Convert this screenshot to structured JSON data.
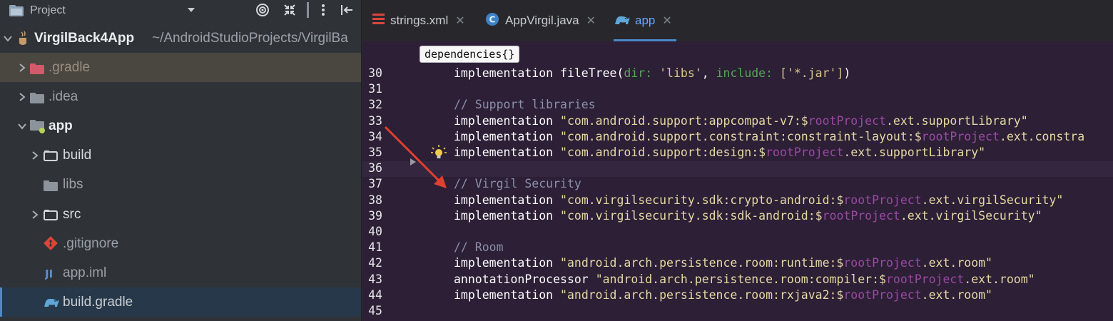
{
  "project_panel": {
    "title": "Project",
    "tree": [
      {
        "label": "VirgilBack4App",
        "path": "~/AndroidStudioProjects/VirgilBa"
      },
      {
        "label": ".gradle"
      },
      {
        "label": ".idea"
      },
      {
        "label": "app"
      },
      {
        "label": "build"
      },
      {
        "label": "libs"
      },
      {
        "label": "src"
      },
      {
        "label": ".gitignore"
      },
      {
        "label": "app.iml"
      },
      {
        "label": "build.gradle"
      }
    ]
  },
  "tabs": [
    {
      "label": "strings.xml"
    },
    {
      "label": "AppVirgil.java"
    },
    {
      "label": "app"
    }
  ],
  "breadcrumb": "dependencies{}",
  "lines": [
    {
      "n": "30",
      "parts": [
        {
          "t": "implementation fileTree(",
          "c": "kw"
        },
        {
          "t": "dir: ",
          "c": "nm"
        },
        {
          "t": "'libs'",
          "c": "sq"
        },
        {
          "t": ", ",
          "c": "kw"
        },
        {
          "t": "include: ",
          "c": "nm"
        },
        {
          "t": "['*.jar']",
          "c": "sq"
        },
        {
          "t": ")",
          "c": "kw"
        }
      ]
    },
    {
      "n": "31",
      "parts": []
    },
    {
      "n": "32",
      "parts": [
        {
          "t": "// Support libraries",
          "c": "cmt"
        }
      ]
    },
    {
      "n": "33",
      "parts": [
        {
          "t": "implementation ",
          "c": "kw"
        },
        {
          "t": "\"com.android.support:appcompat-v7:$",
          "c": "str"
        },
        {
          "t": "rootProject",
          "c": "var"
        },
        {
          "t": ".ext.supportLibrary\"",
          "c": "str"
        }
      ]
    },
    {
      "n": "34",
      "parts": [
        {
          "t": "implementation ",
          "c": "kw"
        },
        {
          "t": "\"com.android.support.constraint:constraint-layout:$",
          "c": "str"
        },
        {
          "t": "rootProject",
          "c": "var"
        },
        {
          "t": ".ext.constra",
          "c": "str"
        }
      ]
    },
    {
      "n": "35",
      "parts": [
        {
          "t": "implementation ",
          "c": "kw"
        },
        {
          "t": "\"com.android.support:design:$",
          "c": "str"
        },
        {
          "t": "rootProject",
          "c": "var"
        },
        {
          "t": ".ext.supportLibrary\"",
          "c": "str"
        }
      ]
    },
    {
      "n": "36",
      "parts": []
    },
    {
      "n": "37",
      "parts": [
        {
          "t": "// Virgil Security",
          "c": "cmt"
        }
      ]
    },
    {
      "n": "38",
      "parts": [
        {
          "t": "implementation ",
          "c": "kw"
        },
        {
          "t": "\"com.virgilsecurity.sdk:crypto-android:$",
          "c": "str"
        },
        {
          "t": "rootProject",
          "c": "var"
        },
        {
          "t": ".ext.virgilSecurity\"",
          "c": "str"
        }
      ]
    },
    {
      "n": "39",
      "parts": [
        {
          "t": "implementation ",
          "c": "kw"
        },
        {
          "t": "\"com.virgilsecurity.sdk:sdk-android:$",
          "c": "str"
        },
        {
          "t": "rootProject",
          "c": "var"
        },
        {
          "t": ".ext.virgilSecurity\"",
          "c": "str"
        }
      ]
    },
    {
      "n": "40",
      "parts": []
    },
    {
      "n": "41",
      "parts": [
        {
          "t": "// Room",
          "c": "cmt"
        }
      ]
    },
    {
      "n": "42",
      "parts": [
        {
          "t": "implementation ",
          "c": "kw"
        },
        {
          "t": "\"android.arch.persistence.room:runtime:$",
          "c": "str"
        },
        {
          "t": "rootProject",
          "c": "var"
        },
        {
          "t": ".ext.room\"",
          "c": "str"
        }
      ]
    },
    {
      "n": "43",
      "parts": [
        {
          "t": "annotationProcessor ",
          "c": "kw"
        },
        {
          "t": "\"android.arch.persistence.room:compiler:$",
          "c": "str"
        },
        {
          "t": "rootProject",
          "c": "var"
        },
        {
          "t": ".ext.room\"",
          "c": "str"
        }
      ]
    },
    {
      "n": "44",
      "parts": [
        {
          "t": "implementation ",
          "c": "kw"
        },
        {
          "t": "\"android.arch.persistence.room:rxjava2:$",
          "c": "str"
        },
        {
          "t": "rootProject",
          "c": "var"
        },
        {
          "t": ".ext.room\"",
          "c": "str"
        }
      ]
    },
    {
      "n": "45",
      "parts": []
    }
  ],
  "colors": {
    "arrow": "#e0402f",
    "accent": "#4a88c7"
  }
}
